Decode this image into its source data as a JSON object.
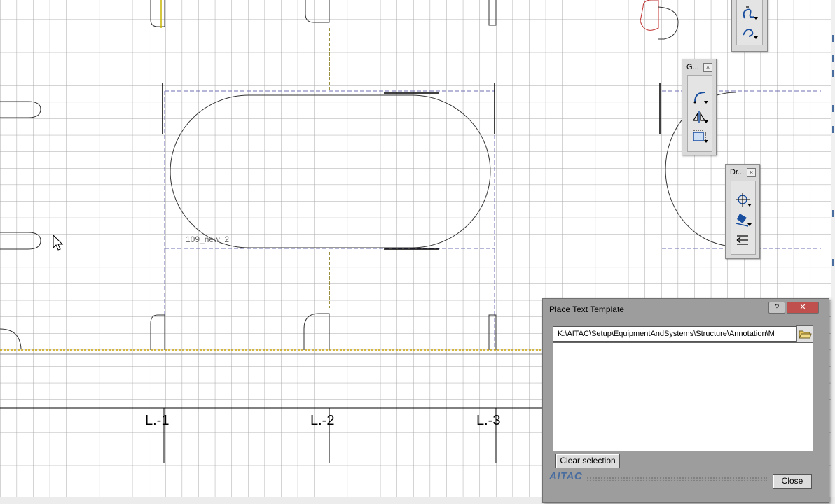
{
  "drawing": {
    "room_label": "109_new_2",
    "grid_labels": [
      "L.-1",
      "L.-2",
      "L.-3"
    ]
  },
  "toolboxes": {
    "top": {
      "title": ""
    },
    "geometry": {
      "title": "G..."
    },
    "drawing": {
      "title": "Dr..."
    }
  },
  "dialog": {
    "title": "Place Text Template",
    "help_label": "?",
    "close_x": "✕",
    "path_value": "K:\\AITAC\\Setup\\EquipmentAndSystems\\Structure\\Annotation\\M",
    "clear_selection_label": "Clear selection",
    "close_label": "Close",
    "logo_text": "AITAC"
  },
  "icons": [
    "arc-icon",
    "mirror-icon",
    "frame-icon",
    "crosshair-icon",
    "fill-icon",
    "arrows-icon",
    "curve-icon"
  ]
}
